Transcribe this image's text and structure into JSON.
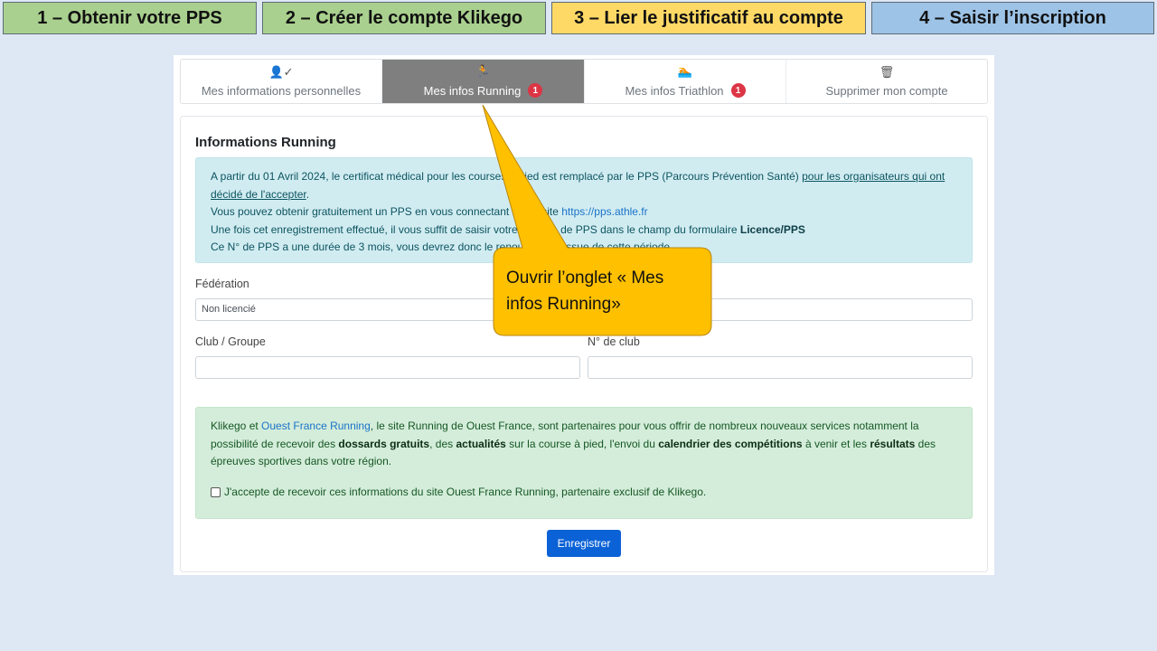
{
  "steps": [
    {
      "label": "1 – Obtenir votre PPS",
      "color": "#a9d08e"
    },
    {
      "label": "2 – Créer le compte Klikego",
      "color": "#a9d08e"
    },
    {
      "label": "3 – Lier le justificatif au compte",
      "color": "#ffd966"
    },
    {
      "label": "4 – Saisir l’inscription",
      "color": "#9dc3e6"
    }
  ],
  "tabs": [
    {
      "label": "Mes informations personnelles",
      "icon": "user-check-icon"
    },
    {
      "label": "Mes infos Running",
      "icon": "running-icon",
      "badge": "1",
      "active": true
    },
    {
      "label": "Mes infos Triathlon",
      "icon": "swimmer-icon",
      "badge": "1"
    },
    {
      "label": "Supprimer mon compte",
      "icon": "trash-icon"
    }
  ],
  "section_title": "Informations Running",
  "info": {
    "line1_pre": "A partir du 01 Avril 2024, le certificat médical pour les courses à pied est remplacé par le PPS (Parcours Prévention Santé) ",
    "line1_link": "pour les organisateurs qui ont décidé de l'accepter",
    "line1_post": ".",
    "line2_pre": "Vous pouvez obtenir gratuitement un PPS en vous connectant sur le site ",
    "line2_link": "https://pps.athle.fr",
    "line3_pre": "Une fois cet enregistrement effectué, il vous suffit de saisir votre numéro de PPS dans le champ du formulaire ",
    "line3_bold": "Licence/PPS",
    "line4": "Ce N° de PPS a une durée de 3 mois, vous devrez donc le renouveler à l'issue de cette période."
  },
  "form": {
    "federation_label": "Fédération",
    "federation_value": "Non licencié",
    "club_label": "Club / Groupe",
    "club_number_label": "N° de club"
  },
  "partner": {
    "t1": "Klikego et ",
    "link": "Ouest France Running",
    "t2": ", le site Running de Ouest France, sont partenaires pour vous offrir de nombreux nouveaux services notamment la possibilité de recevoir des ",
    "b1": "dossards gratuits",
    "t3": ", des ",
    "b2": "actualités",
    "t4": " sur la course à pied, l'envoi du ",
    "b3": "calendrier des compétitions",
    "t5": " à venir et les ",
    "b4": "résultats",
    "t6": " des épreuves sportives dans votre région.",
    "consent": "J'accepte de recevoir ces informations du site Ouest France Running, partenaire exclusif de Klikego."
  },
  "save_label": "Enregistrer",
  "callout": {
    "text": "Ouvrir l’onglet « Mes infos Running»",
    "color": "#ffc000"
  }
}
